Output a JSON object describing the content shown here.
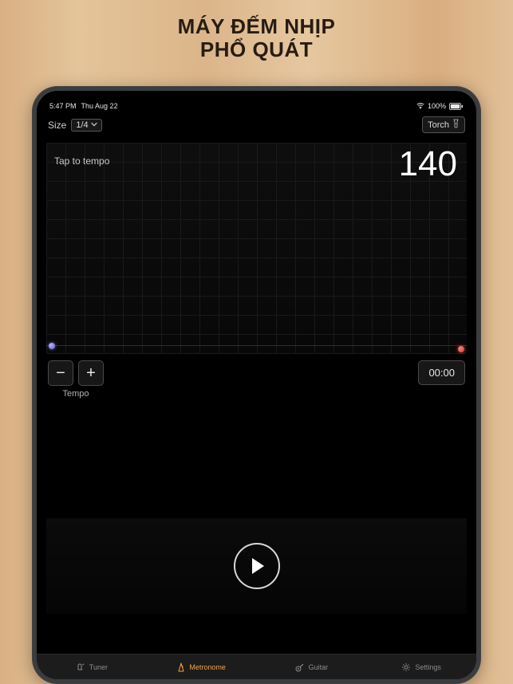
{
  "promo": {
    "line1": "MÁY ĐẾM NHỊP",
    "line2": "PHỔ QUÁT"
  },
  "status": {
    "time": "5:47 PM",
    "date": "Thu Aug 22",
    "battery_pct": "100%"
  },
  "top": {
    "size_label": "Size",
    "size_value": "1/4",
    "torch_label": "Torch"
  },
  "grid": {
    "tap_hint": "Tap to tempo",
    "bpm": "140"
  },
  "tempo": {
    "minus": "−",
    "plus": "+",
    "label": "Tempo",
    "timer": "00:00"
  },
  "tabs": {
    "tuner": "Tuner",
    "metronome": "Metronome",
    "guitar": "Guitar",
    "settings": "Settings"
  }
}
